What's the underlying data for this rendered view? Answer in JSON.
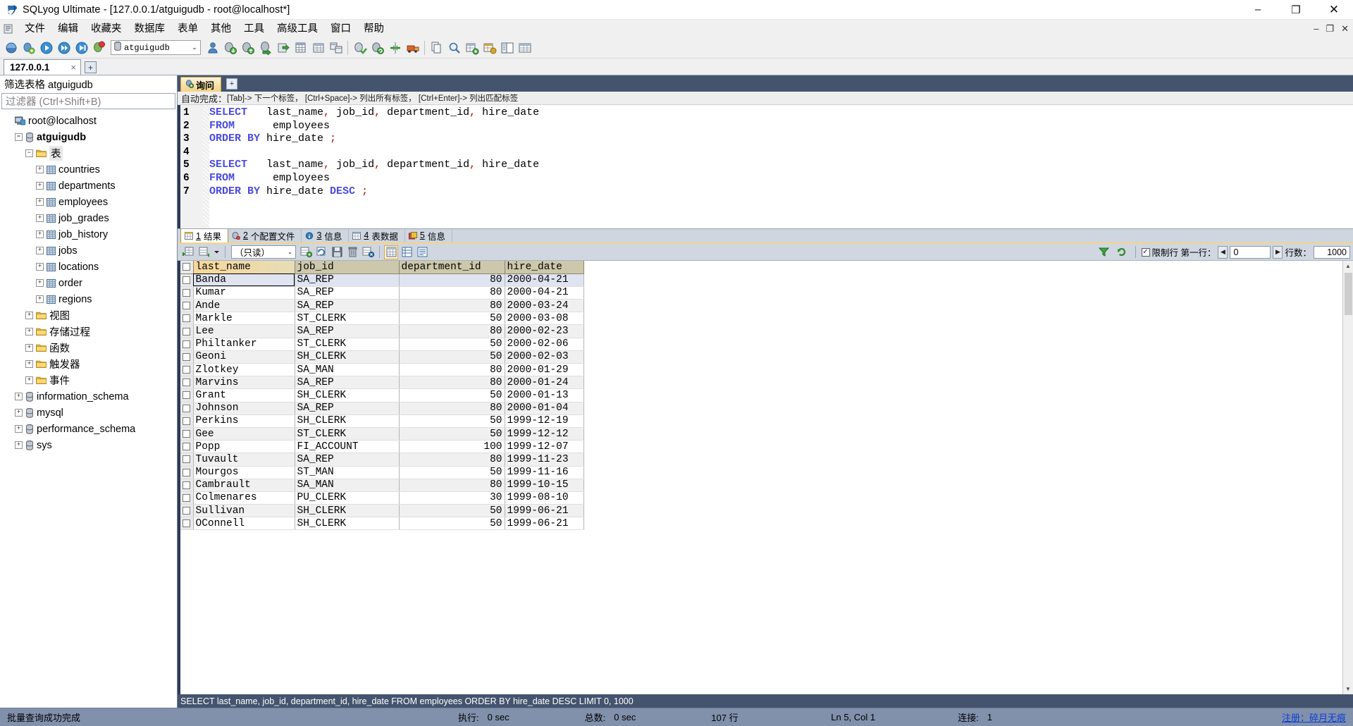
{
  "window": {
    "title": "SQLyog Ultimate - [127.0.0.1/atguigudb - root@localhost*]",
    "app_icon": "sqlyog-icon",
    "minimize": "–",
    "maximize": "❐",
    "close": "✕",
    "mdi_minimize": "–",
    "mdi_restore": "❐",
    "mdi_close": "✕"
  },
  "menubar": {
    "items": [
      {
        "label": "文件",
        "name": "menu-file"
      },
      {
        "label": "编辑",
        "name": "menu-edit"
      },
      {
        "label": "收藏夹",
        "name": "menu-favorites"
      },
      {
        "label": "数据库",
        "name": "menu-database"
      },
      {
        "label": "表单",
        "name": "menu-table"
      },
      {
        "label": "其他",
        "name": "menu-other"
      },
      {
        "label": "工具",
        "name": "menu-tools"
      },
      {
        "label": "高级工具",
        "name": "menu-advanced-tools"
      },
      {
        "label": "窗口",
        "name": "menu-window"
      },
      {
        "label": "帮助",
        "name": "menu-help"
      }
    ]
  },
  "toolbar": {
    "database_combo_value": "atguigudb",
    "combo_arrow": "⌄"
  },
  "connection_tabs": {
    "tabs": [
      {
        "label": "127.0.0.1",
        "close": "×"
      }
    ],
    "new_tab": "+"
  },
  "sidebar": {
    "filter_title": "筛选表格 atguigudb",
    "filter_placeholder": "过滤器 (Ctrl+Shift+B)",
    "tree": [
      {
        "label": "root@localhost",
        "indent": 0,
        "expander": "",
        "icon": "host-icon",
        "bold": false
      },
      {
        "label": "atguigudb",
        "indent": 1,
        "expander": "−",
        "icon": "db-icon",
        "bold": true
      },
      {
        "label": "表",
        "indent": 2,
        "expander": "−",
        "icon": "folder-icon",
        "bold": false,
        "selected": true
      },
      {
        "label": "countries",
        "indent": 3,
        "expander": "+",
        "icon": "table-icon",
        "bold": false
      },
      {
        "label": "departments",
        "indent": 3,
        "expander": "+",
        "icon": "table-icon",
        "bold": false
      },
      {
        "label": "employees",
        "indent": 3,
        "expander": "+",
        "icon": "table-icon",
        "bold": false
      },
      {
        "label": "job_grades",
        "indent": 3,
        "expander": "+",
        "icon": "table-icon",
        "bold": false
      },
      {
        "label": "job_history",
        "indent": 3,
        "expander": "+",
        "icon": "table-icon",
        "bold": false
      },
      {
        "label": "jobs",
        "indent": 3,
        "expander": "+",
        "icon": "table-icon",
        "bold": false
      },
      {
        "label": "locations",
        "indent": 3,
        "expander": "+",
        "icon": "table-icon",
        "bold": false
      },
      {
        "label": "order",
        "indent": 3,
        "expander": "+",
        "icon": "table-icon",
        "bold": false
      },
      {
        "label": "regions",
        "indent": 3,
        "expander": "+",
        "icon": "table-icon",
        "bold": false
      },
      {
        "label": "视图",
        "indent": 2,
        "expander": "+",
        "icon": "folder-icon",
        "bold": false
      },
      {
        "label": "存储过程",
        "indent": 2,
        "expander": "+",
        "icon": "folder-icon",
        "bold": false
      },
      {
        "label": "函数",
        "indent": 2,
        "expander": "+",
        "icon": "folder-icon",
        "bold": false
      },
      {
        "label": "触发器",
        "indent": 2,
        "expander": "+",
        "icon": "folder-icon",
        "bold": false
      },
      {
        "label": "事件",
        "indent": 2,
        "expander": "+",
        "icon": "folder-icon",
        "bold": false
      },
      {
        "label": "information_schema",
        "indent": 1,
        "expander": "+",
        "icon": "db-icon",
        "bold": false
      },
      {
        "label": "mysql",
        "indent": 1,
        "expander": "+",
        "icon": "db-icon",
        "bold": false
      },
      {
        "label": "performance_schema",
        "indent": 1,
        "expander": "+",
        "icon": "db-icon",
        "bold": false
      },
      {
        "label": "sys",
        "indent": 1,
        "expander": "+",
        "icon": "db-icon",
        "bold": false
      }
    ]
  },
  "query_tabs": {
    "tabs": [
      {
        "label": "询问",
        "icon": "query-icon"
      }
    ],
    "new_tab": "+"
  },
  "editor": {
    "autocomplete_hint_prefix": "自动完成：",
    "autocomplete_hint": "[Tab]-> 下一个标签， [Ctrl+Space]-> 列出所有标签， [Ctrl+Enter]-> 列出匹配标签",
    "line_numbers": [
      "1",
      "2",
      "3",
      "4",
      "5",
      "6",
      "7"
    ],
    "lines": [
      {
        "n": 1,
        "selected": false,
        "tokens": [
          {
            "t": "SELECT",
            "c": "kw"
          },
          {
            "t": "   last_name",
            "c": ""
          },
          {
            "t": ",",
            "c": "pn"
          },
          {
            "t": " job_id",
            "c": ""
          },
          {
            "t": ",",
            "c": "pn"
          },
          {
            "t": " department_id",
            "c": ""
          },
          {
            "t": ",",
            "c": "pn"
          },
          {
            "t": " hire_date",
            "c": ""
          }
        ]
      },
      {
        "n": 2,
        "selected": false,
        "tokens": [
          {
            "t": "FROM",
            "c": "kw"
          },
          {
            "t": "      employees",
            "c": ""
          }
        ]
      },
      {
        "n": 3,
        "selected": false,
        "tokens": [
          {
            "t": "ORDER BY",
            "c": "kw"
          },
          {
            "t": " hire_date ",
            "c": ""
          },
          {
            "t": ";",
            "c": "pn"
          }
        ]
      },
      {
        "n": 4,
        "selected": false,
        "tokens": [
          {
            "t": "",
            "c": ""
          }
        ]
      },
      {
        "n": 5,
        "selected": true,
        "tokens": [
          {
            "t": "SELECT",
            "c": "kw"
          },
          {
            "t": "   last_name",
            "c": ""
          },
          {
            "t": ",",
            "c": "pn"
          },
          {
            "t": " job_id",
            "c": ""
          },
          {
            "t": ",",
            "c": "pn"
          },
          {
            "t": " department_id",
            "c": ""
          },
          {
            "t": ",",
            "c": "pn"
          },
          {
            "t": " hire_date",
            "c": ""
          }
        ]
      },
      {
        "n": 6,
        "selected": true,
        "tokens": [
          {
            "t": "FROM",
            "c": "kw"
          },
          {
            "t": "      employees ",
            "c": ""
          }
        ]
      },
      {
        "n": 7,
        "selected": true,
        "tokens": [
          {
            "t": "ORDER BY",
            "c": "kw"
          },
          {
            "t": " hire_date ",
            "c": ""
          },
          {
            "t": "DESC",
            "c": "kw"
          },
          {
            "t": " ",
            "c": ""
          },
          {
            "t": ";",
            "c": "pn"
          }
        ]
      }
    ]
  },
  "result_tabs": [
    {
      "num": "1",
      "label": "结果",
      "icon": "grid-icon",
      "active": true
    },
    {
      "num": "2",
      "label": "个配置文件",
      "icon": "profile-icon",
      "active": false
    },
    {
      "num": "3",
      "label": "信息",
      "icon": "info-icon",
      "active": false
    },
    {
      "num": "4",
      "label": "表数据",
      "icon": "table-data-icon",
      "active": false
    },
    {
      "num": "5",
      "label": "信息",
      "icon": "messages-icon",
      "active": false
    }
  ],
  "grid_toolbar": {
    "readonly_label": "（只读）",
    "readonly_arrow": "⌄",
    "limit_checkbox_label": "限制行 第一行：",
    "limit_checked": "✓",
    "offset_value": "0",
    "rows_label": "行数：",
    "rows_value": "1000",
    "prev_arrow": "◀",
    "next_arrow": "▶"
  },
  "grid": {
    "columns": [
      "last_name",
      "job_id",
      "department_id",
      "hire_date"
    ],
    "rows": [
      [
        "Banda",
        "SA_REP",
        "80",
        "2000-04-21"
      ],
      [
        "Kumar",
        "SA_REP",
        "80",
        "2000-04-21"
      ],
      [
        "Ande",
        "SA_REP",
        "80",
        "2000-03-24"
      ],
      [
        "Markle",
        "ST_CLERK",
        "50",
        "2000-03-08"
      ],
      [
        "Lee",
        "SA_REP",
        "80",
        "2000-02-23"
      ],
      [
        "Philtanker",
        "ST_CLERK",
        "50",
        "2000-02-06"
      ],
      [
        "Geoni",
        "SH_CLERK",
        "50",
        "2000-02-03"
      ],
      [
        "Zlotkey",
        "SA_MAN",
        "80",
        "2000-01-29"
      ],
      [
        "Marvins",
        "SA_REP",
        "80",
        "2000-01-24"
      ],
      [
        "Grant",
        "SH_CLERK",
        "50",
        "2000-01-13"
      ],
      [
        "Johnson",
        "SA_REP",
        "80",
        "2000-01-04"
      ],
      [
        "Perkins",
        "SH_CLERK",
        "50",
        "1999-12-19"
      ],
      [
        "Gee",
        "ST_CLERK",
        "50",
        "1999-12-12"
      ],
      [
        "Popp",
        "FI_ACCOUNT",
        "100",
        "1999-12-07"
      ],
      [
        "Tuvault",
        "SA_REP",
        "80",
        "1999-11-23"
      ],
      [
        "Mourgos",
        "ST_MAN",
        "50",
        "1999-11-16"
      ],
      [
        "Cambrault",
        "SA_MAN",
        "80",
        "1999-10-15"
      ],
      [
        "Colmenares",
        "PU_CLERK",
        "30",
        "1999-08-10"
      ],
      [
        "Sullivan",
        "SH_CLERK",
        "50",
        "1999-06-21"
      ],
      [
        "OConnell",
        "SH_CLERK",
        "50",
        "1999-06-21"
      ]
    ]
  },
  "query_echo": "SELECT last_name, job_id, department_id, hire_date FROM employees ORDER BY hire_date DESC LIMIT 0, 1000",
  "statusbar": {
    "message": "批量查询成功完成",
    "exec_label": "执行:",
    "exec_value": "0 sec",
    "total_label": "总数:",
    "total_value": "0 sec",
    "rows": "107 行",
    "caret": "Ln 5, Col 1",
    "conn_label": "连接:",
    "conn_value": "1",
    "register_link": "注册：碎月无痕"
  },
  "colors": {
    "keyword": "#4a4ae0",
    "punct": "#c00000",
    "tab_active": "#f3d183",
    "panel_dark": "#44546e",
    "statusbar": "#8190ab"
  }
}
